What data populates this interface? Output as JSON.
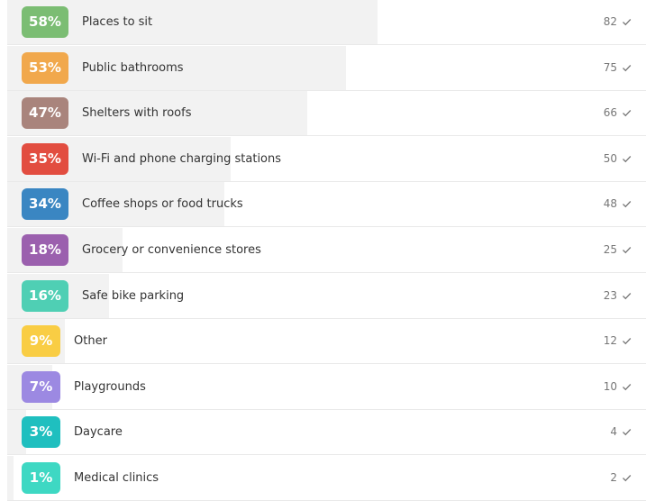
{
  "results": [
    {
      "percent": "58%",
      "label": "Places to sit",
      "count": "82",
      "share": 0.58,
      "color": "#7bbd73"
    },
    {
      "percent": "53%",
      "label": "Public bathrooms",
      "count": "75",
      "share": 0.53,
      "color": "#f1a84c"
    },
    {
      "percent": "47%",
      "label": "Shelters with roofs",
      "count": "66",
      "share": 0.47,
      "color": "#a9847c"
    },
    {
      "percent": "35%",
      "label": "Wi-Fi and phone charging stations",
      "count": "50",
      "share": 0.35,
      "color": "#e24d40"
    },
    {
      "percent": "34%",
      "label": "Coffee shops or food trucks",
      "count": "48",
      "share": 0.34,
      "color": "#3a86c2"
    },
    {
      "percent": "18%",
      "label": "Grocery or convenience stores",
      "count": "25",
      "share": 0.18,
      "color": "#9b60ae"
    },
    {
      "percent": "16%",
      "label": "Safe bike parking",
      "count": "23",
      "share": 0.16,
      "color": "#4fcfb4"
    },
    {
      "percent": "9%",
      "label": "Other",
      "count": "12",
      "share": 0.09,
      "color": "#f9cd44"
    },
    {
      "percent": "7%",
      "label": "Playgrounds",
      "count": "10",
      "share": 0.07,
      "color": "#9c89e2"
    },
    {
      "percent": "3%",
      "label": "Daycare",
      "count": "4",
      "share": 0.03,
      "color": "#1fbfbf"
    },
    {
      "percent": "1%",
      "label": "Medical clinics",
      "count": "2",
      "share": 0.01,
      "color": "#3ed8c3"
    }
  ],
  "icons": {
    "check": "check-icon"
  }
}
